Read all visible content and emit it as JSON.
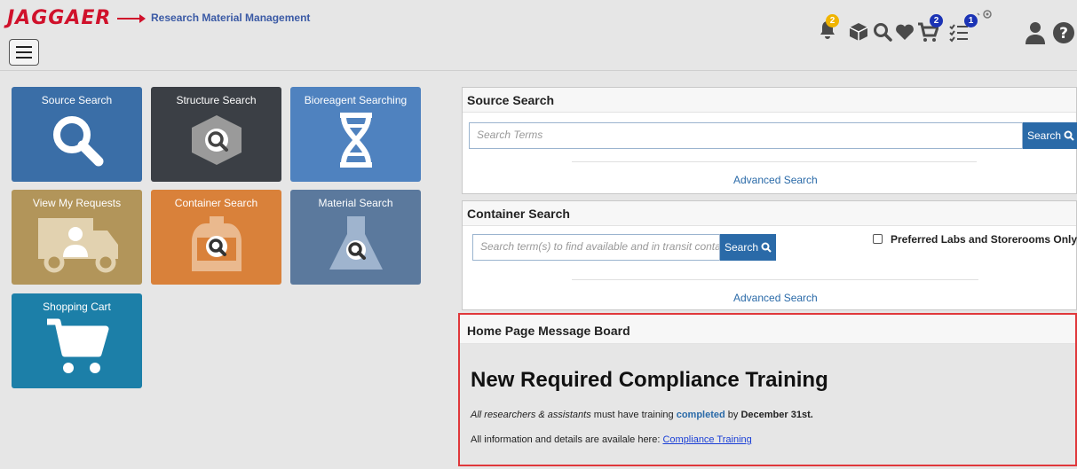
{
  "header": {
    "logo": "JAGGAER",
    "app_title": "Research Material Management",
    "notification_count": "2",
    "cart_count": "2",
    "tasks_count": "1"
  },
  "tiles": [
    {
      "label": "Source Search",
      "color": "#3a6ea7",
      "icon": "search-icon"
    },
    {
      "label": "Structure Search",
      "color": "#3b3f45",
      "icon": "molecule-box-icon"
    },
    {
      "label": "Bioreagent Searching",
      "color": "#4f82bf",
      "icon": "dna-icon"
    },
    {
      "label": "View My Requests",
      "color": "#b2955a",
      "icon": "truck-icon"
    },
    {
      "label": "Container Search",
      "color": "#d9813a",
      "icon": "container-icon"
    },
    {
      "label": "Material Search",
      "color": "#5b799d",
      "icon": "flask-icon"
    },
    {
      "label": "Shopping Cart",
      "color": "#1c7fa8",
      "icon": "cart-icon"
    }
  ],
  "source_search": {
    "heading": "Source Search",
    "placeholder": "Search Terms",
    "button": "Search",
    "advanced": "Advanced Search"
  },
  "container_search": {
    "heading": "Container Search",
    "placeholder": "Search term(s) to find available and in transit containers",
    "button": "Search",
    "checkbox_label": "Preferred Labs and Storerooms Only",
    "advanced": "Advanced Search"
  },
  "message_board": {
    "heading": "Home Page Message Board",
    "title": "New Required Compliance Training",
    "line1_a": "All researchers & assistants",
    "line1_b": " must have training ",
    "line1_c": "completed",
    "line1_d": " by ",
    "line1_e": "December 31st.",
    "line2": "All information and details are availale here: ",
    "link": "Compliance Training"
  }
}
